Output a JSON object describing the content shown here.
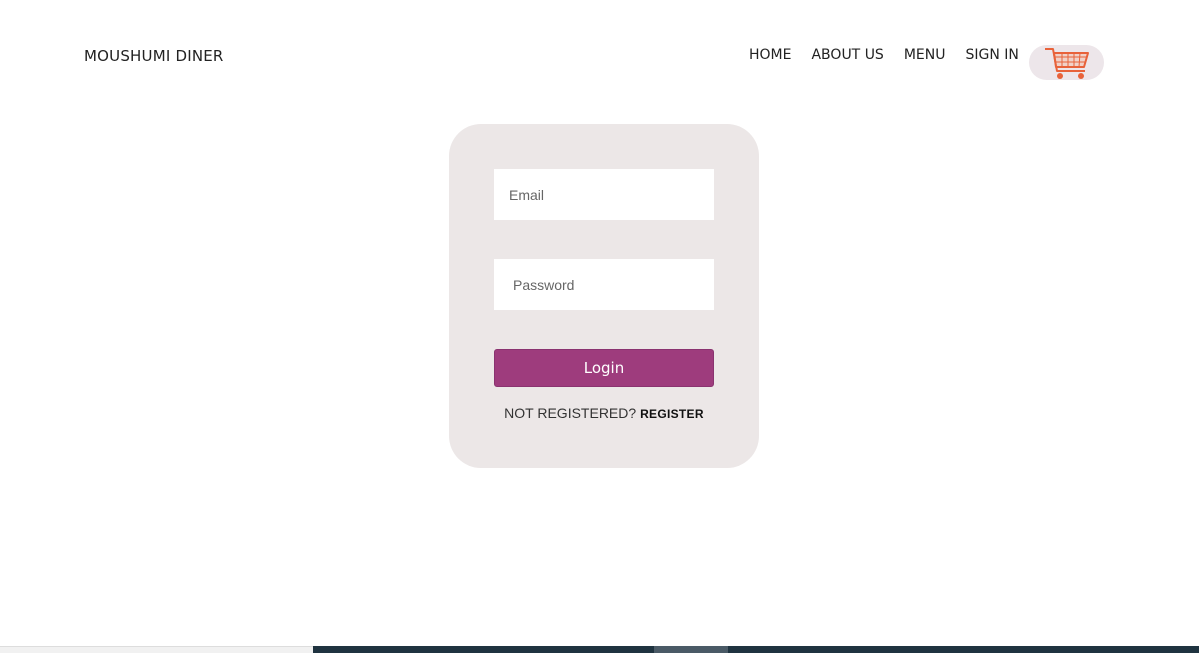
{
  "header": {
    "brand": "MOUSHUMI DINER",
    "nav": [
      "HOME",
      "ABOUT US",
      "MENU",
      "SIGN IN"
    ],
    "cart_icon": "shopping-cart-icon",
    "cart_color": "#e8623a"
  },
  "login": {
    "email_placeholder": "Email",
    "password_placeholder": "Password",
    "login_label": "Login",
    "not_registered": "NOT REGISTERED?",
    "register_label": "REGISTER"
  },
  "colors": {
    "accent": "#9e3c7d",
    "card_bg": "#ece7e7"
  }
}
